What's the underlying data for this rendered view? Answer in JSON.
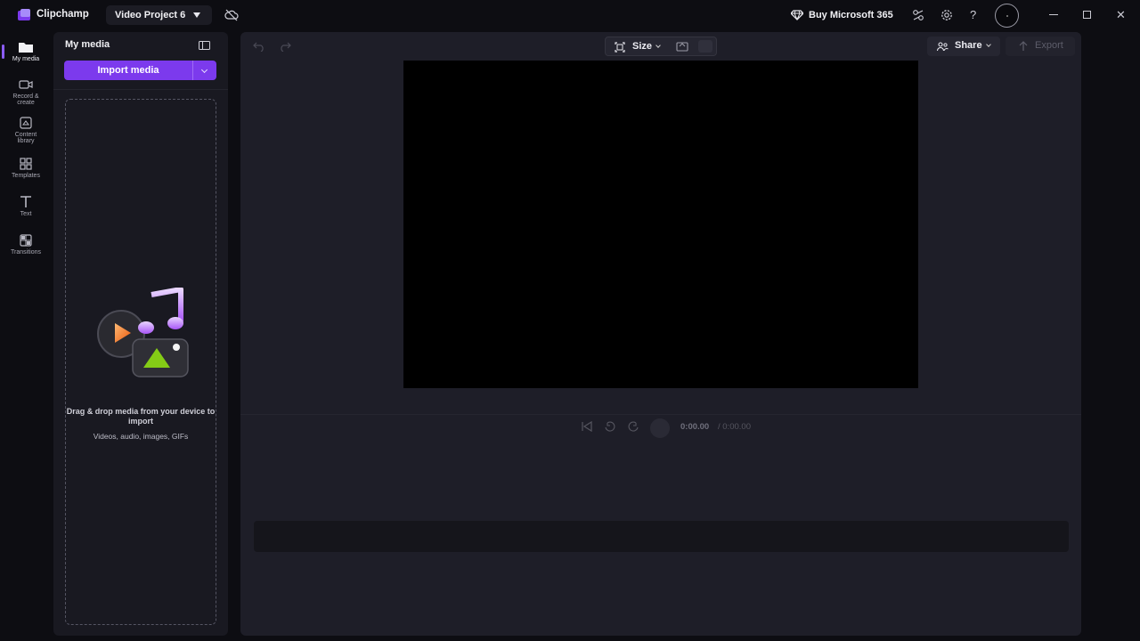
{
  "titlebar": {
    "app_name": "Clipchamp",
    "project_name": "Video Project 6",
    "buy_label": "Buy Microsoft 365",
    "icons": [
      "clipchamp-logo",
      "cloud-off-icon",
      "diamond-icon",
      "share-alt-icon",
      "gear-icon",
      "help-icon",
      "avatar",
      "minimize",
      "maximize",
      "close"
    ],
    "help_glyph": "?",
    "close_glyph": "✕"
  },
  "rail": {
    "items": [
      {
        "label": "My media",
        "icon": "folder-icon",
        "active": true
      },
      {
        "label": "Record & create",
        "icon": "camera-icon",
        "active": false
      },
      {
        "label": "Content library",
        "icon": "library-icon",
        "active": false
      },
      {
        "label": "Templates",
        "icon": "templates-icon",
        "active": false
      },
      {
        "label": "Text",
        "icon": "text-icon",
        "active": false
      },
      {
        "label": "Transitions",
        "icon": "transitions-icon",
        "active": false
      }
    ]
  },
  "media_panel": {
    "title": "My media",
    "import_label": "Import media",
    "dropzone_title": "Drag & drop media from your device to import",
    "dropzone_sub": "Videos, audio, images, GIFs"
  },
  "editor": {
    "size_label": "Size",
    "share_label": "Share",
    "export_label": "Export",
    "time_current": "0:00.00",
    "time_total": "/ 0:00.00"
  },
  "colors": {
    "accent": "#7c3aed",
    "background": "#0d0d12",
    "panel": "#191921",
    "editor": "#1e1e28",
    "preview": "#000000"
  }
}
